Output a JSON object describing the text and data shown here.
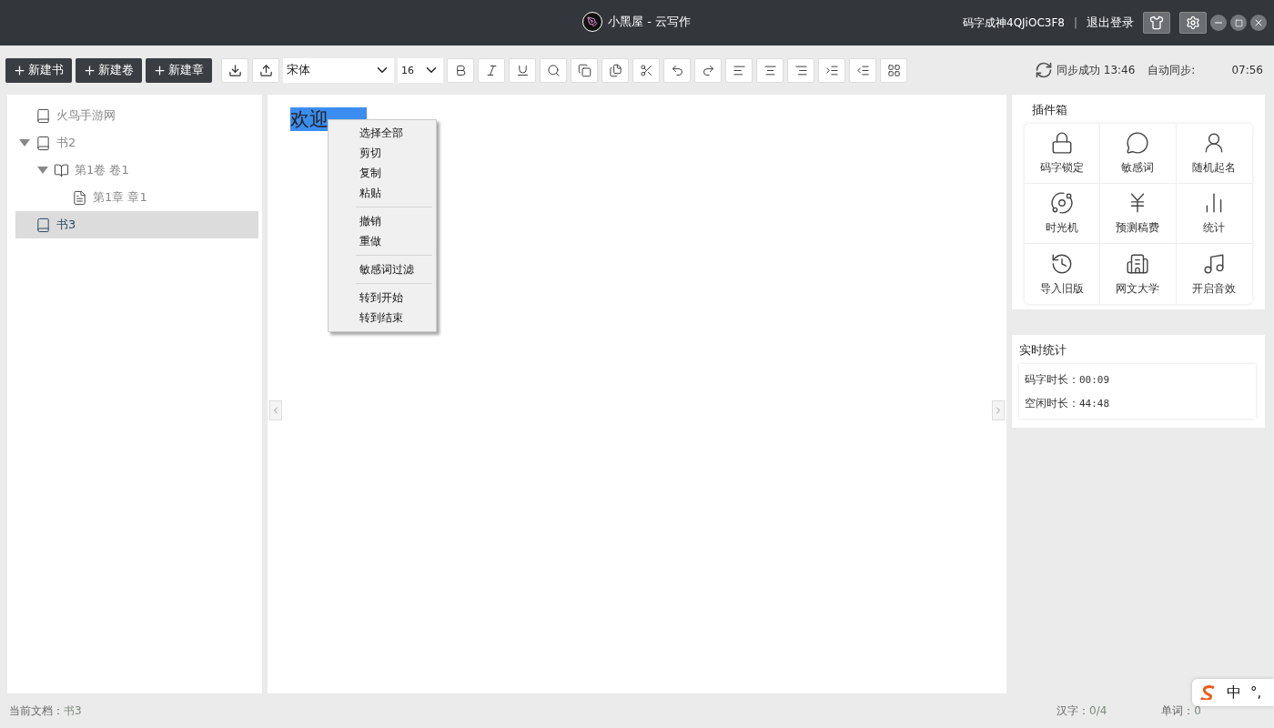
{
  "window": {
    "title": "小黑屋 - 云写作",
    "user": "码字成神4QJiOC3F8",
    "separator": "|",
    "logout": "退出登录"
  },
  "toolbar": {
    "new_buttons": [
      "新建书",
      "新建卷",
      "新建章"
    ],
    "font": "宋体",
    "size": "16",
    "sync_status": "同步成功",
    "sync_time": "13:46",
    "auto_sync_label": "自动同步:",
    "auto_sync_time": "07:56"
  },
  "tree": [
    {
      "label": "火鸟手游网",
      "kind": "book",
      "selected": false
    },
    {
      "label": "书2",
      "kind": "book",
      "selected": false,
      "expanded": true,
      "children": [
        {
          "label": "第1卷 卷1",
          "kind": "volume",
          "selected": false,
          "expanded": true,
          "children": [
            {
              "label": "第1章 章1",
              "kind": "chapter",
              "selected": false
            }
          ]
        }
      ]
    },
    {
      "label": "书3",
      "kind": "book",
      "selected": true
    }
  ],
  "editor": {
    "text": "欢迎"
  },
  "context_menu": [
    [
      "选择全部",
      "剪切",
      "复制",
      "粘贴"
    ],
    [
      "撤销",
      "重做"
    ],
    [
      "敏感词过滤"
    ],
    [
      "转到开始",
      "转到结束"
    ]
  ],
  "plugins": {
    "title": "插件箱",
    "items": [
      "码字锁定",
      "敏感词",
      "随机起名",
      "时光机",
      "预测稿费",
      "统计",
      "导入旧版",
      "网文大学",
      "开启音效"
    ]
  },
  "stats": {
    "title": "实时统计",
    "rows": [
      {
        "label": "码字时长：",
        "value": "00:09"
      },
      {
        "label": "空闲时长：",
        "value": "44:48"
      }
    ]
  },
  "status_bar": {
    "doc_label": "当前文档：",
    "doc": "书3",
    "chars_label": "汉字：",
    "chars": "0/4",
    "words_label": "单词：",
    "words": "0"
  },
  "ime": {
    "mode": "中",
    "punct": "°,"
  }
}
